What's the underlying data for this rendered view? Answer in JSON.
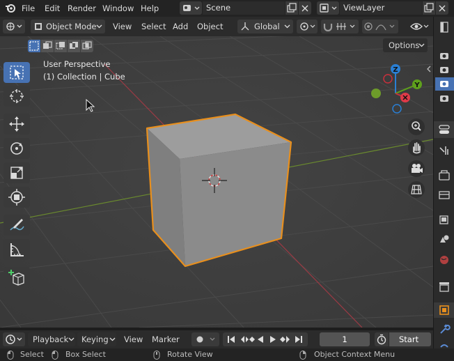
{
  "menu": {
    "items": [
      "File",
      "Edit",
      "Render",
      "Window",
      "Help"
    ],
    "scene_label": "Scene",
    "viewlayer_label": "ViewLayer"
  },
  "header": {
    "mode": "Object Mode",
    "menus": [
      "View",
      "Select",
      "Add",
      "Object"
    ],
    "transform_orientation": "Global",
    "options_label": "Options"
  },
  "viewport": {
    "perspective_label": "User Perspective",
    "collection_label": "(1) Collection | Cube",
    "gizmo_axes": [
      "Z",
      "Y"
    ],
    "selected_color": "#e88f1d",
    "accent_color": "#4772b3"
  },
  "timeline": {
    "menus": [
      "Playback",
      "Keying",
      "View",
      "Marker"
    ],
    "current_frame": "1",
    "start_label": "Start"
  },
  "status": {
    "select": "Select",
    "box_select": "Box Select",
    "rotate_view": "Rotate View",
    "context_menu": "Object Context Menu"
  }
}
